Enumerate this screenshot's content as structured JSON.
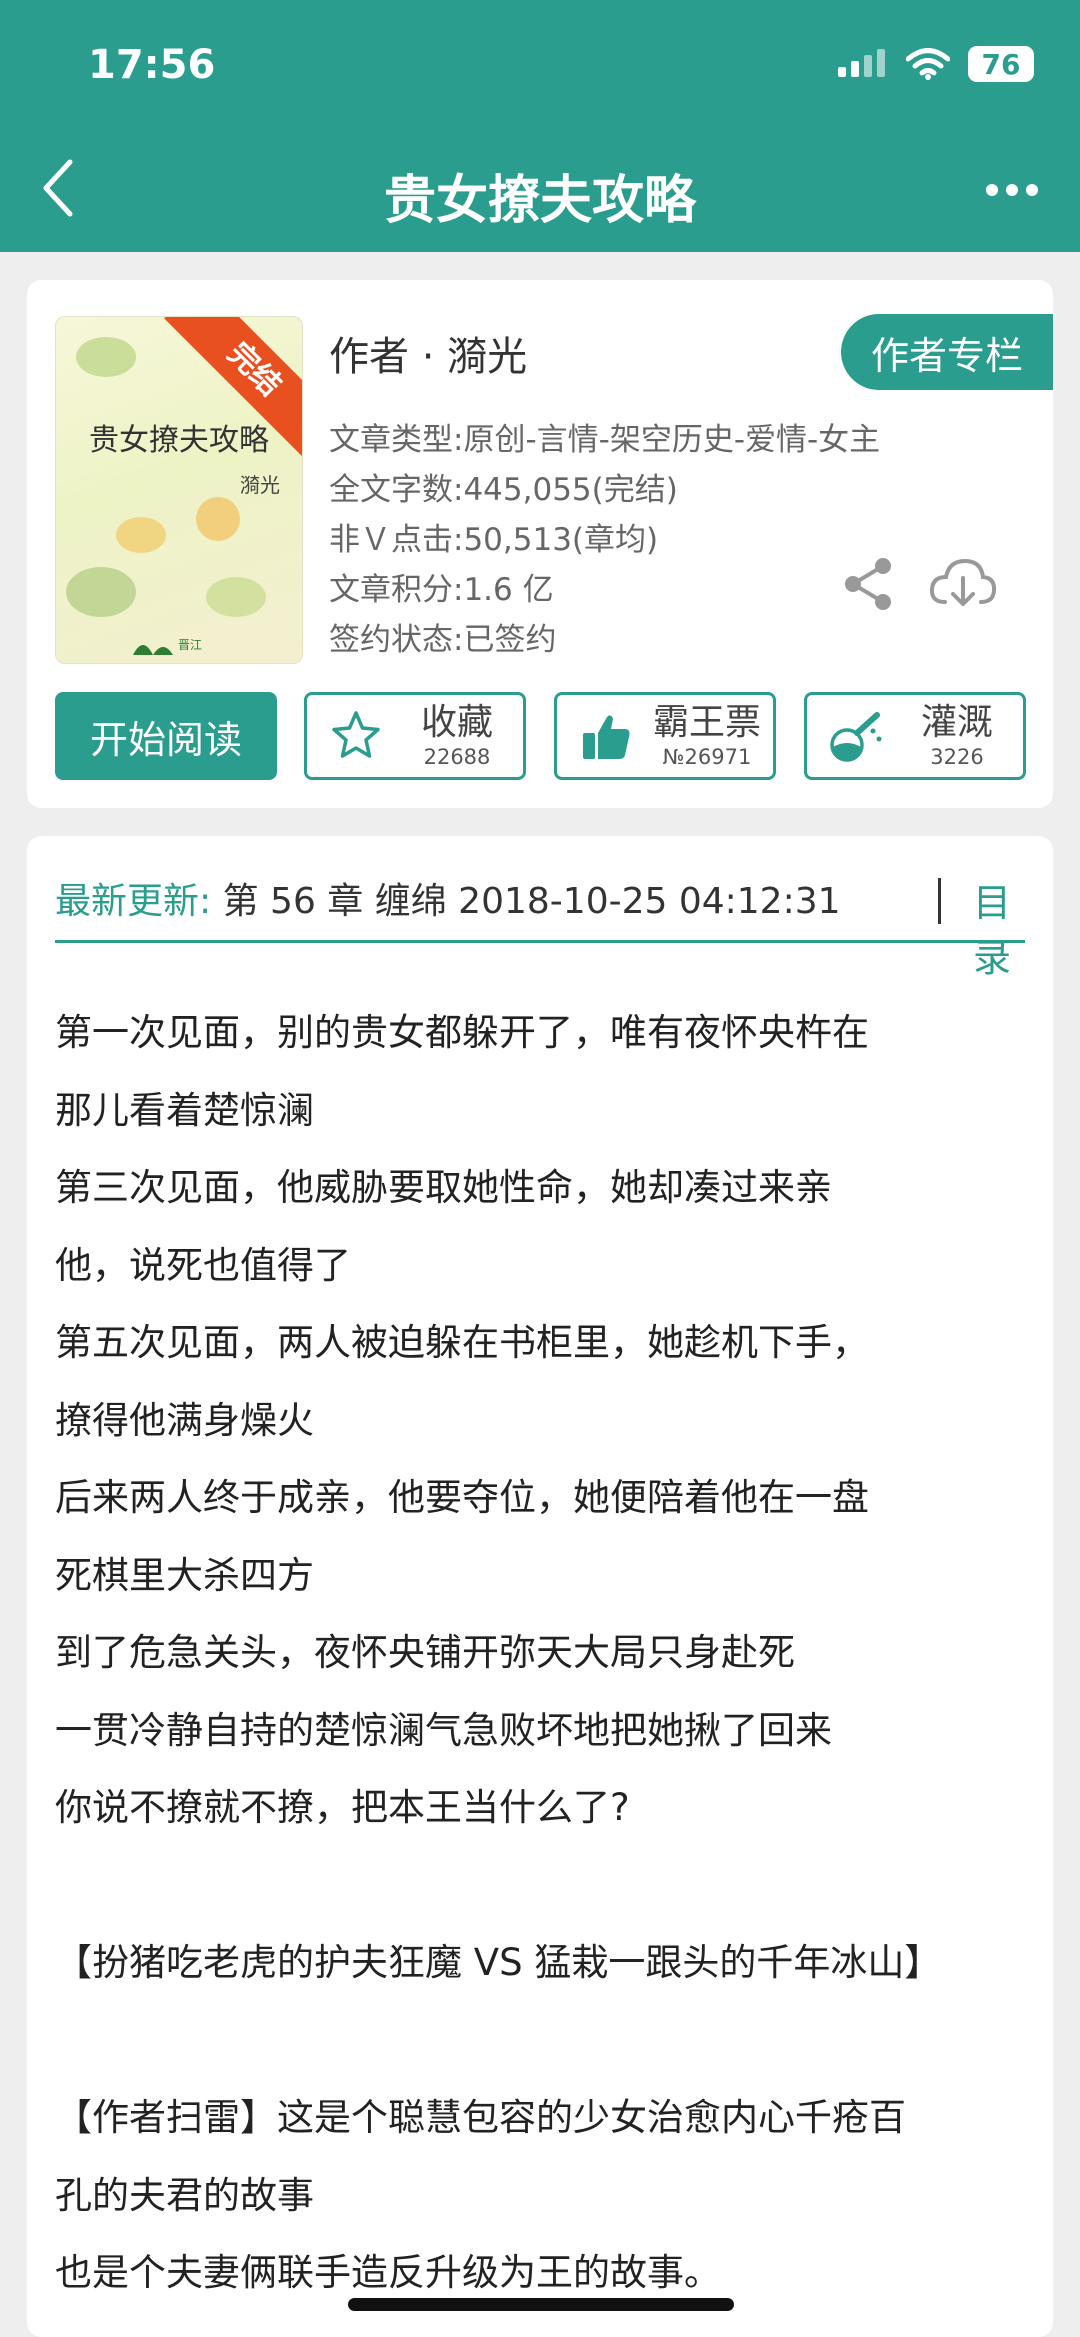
{
  "status": {
    "time": "17:56",
    "battery": "76"
  },
  "nav": {
    "title": "贵女撩夫攻略"
  },
  "book": {
    "cover_title": "贵女撩夫攻略",
    "cover_author": "漪光",
    "cover_badge": "完结",
    "author": "作者 · 漪光",
    "author_column_label": "作者专栏",
    "type": "文章类型:原创-言情-架空历史-爱情-女主",
    "word_count": "全文字数:445,055(完结)",
    "clicks": "非Ｖ点击:50,513(章均)",
    "score": "文章积分:1.6 亿",
    "contract": "签约状态:已签约"
  },
  "actions": {
    "read_label": "开始阅读",
    "favorite_label": "收藏",
    "favorite_count": "22688",
    "vote_label": "霸王票",
    "vote_count": "№26971",
    "nutrient_label": "灌溉",
    "nutrient_count": "3226"
  },
  "update": {
    "label": "最新更新:",
    "text": "第 56 章 缠绵 2018-10-25 04:12:31",
    "toc_label": "目录"
  },
  "summary": [
    "第一次见面，别的贵女都躲开了，唯有夜怀央杵在",
    "那儿看着楚惊澜",
    "第三次见面，他威胁要取她性命，她却凑过来亲",
    "他，说死也值得了",
    "第五次见面，两人被迫躲在书柜里，她趁机下手，",
    "撩得他满身燥火",
    "后来两人终于成亲，他要夺位，她便陪着他在一盘",
    "死棋里大杀四方",
    "到了危急关头，夜怀央铺开弥天大局只身赴死",
    "一贯冷静自持的楚惊澜气急败坏地把她揪了回来",
    "你说不撩就不撩，把本王当什么了?",
    "",
    "【扮猪吃老虎的护夫狂魔 VS 猛栽一跟头的千年冰山】",
    "",
    "【作者扫雷】这是个聪慧包容的少女治愈内心千疮百",
    "孔的夫君的故事",
    "也是个夫妻俩联手造反升级为王的故事。"
  ],
  "colors": {
    "accent": "#2a9d8f",
    "ribbon": "#e8501f"
  }
}
